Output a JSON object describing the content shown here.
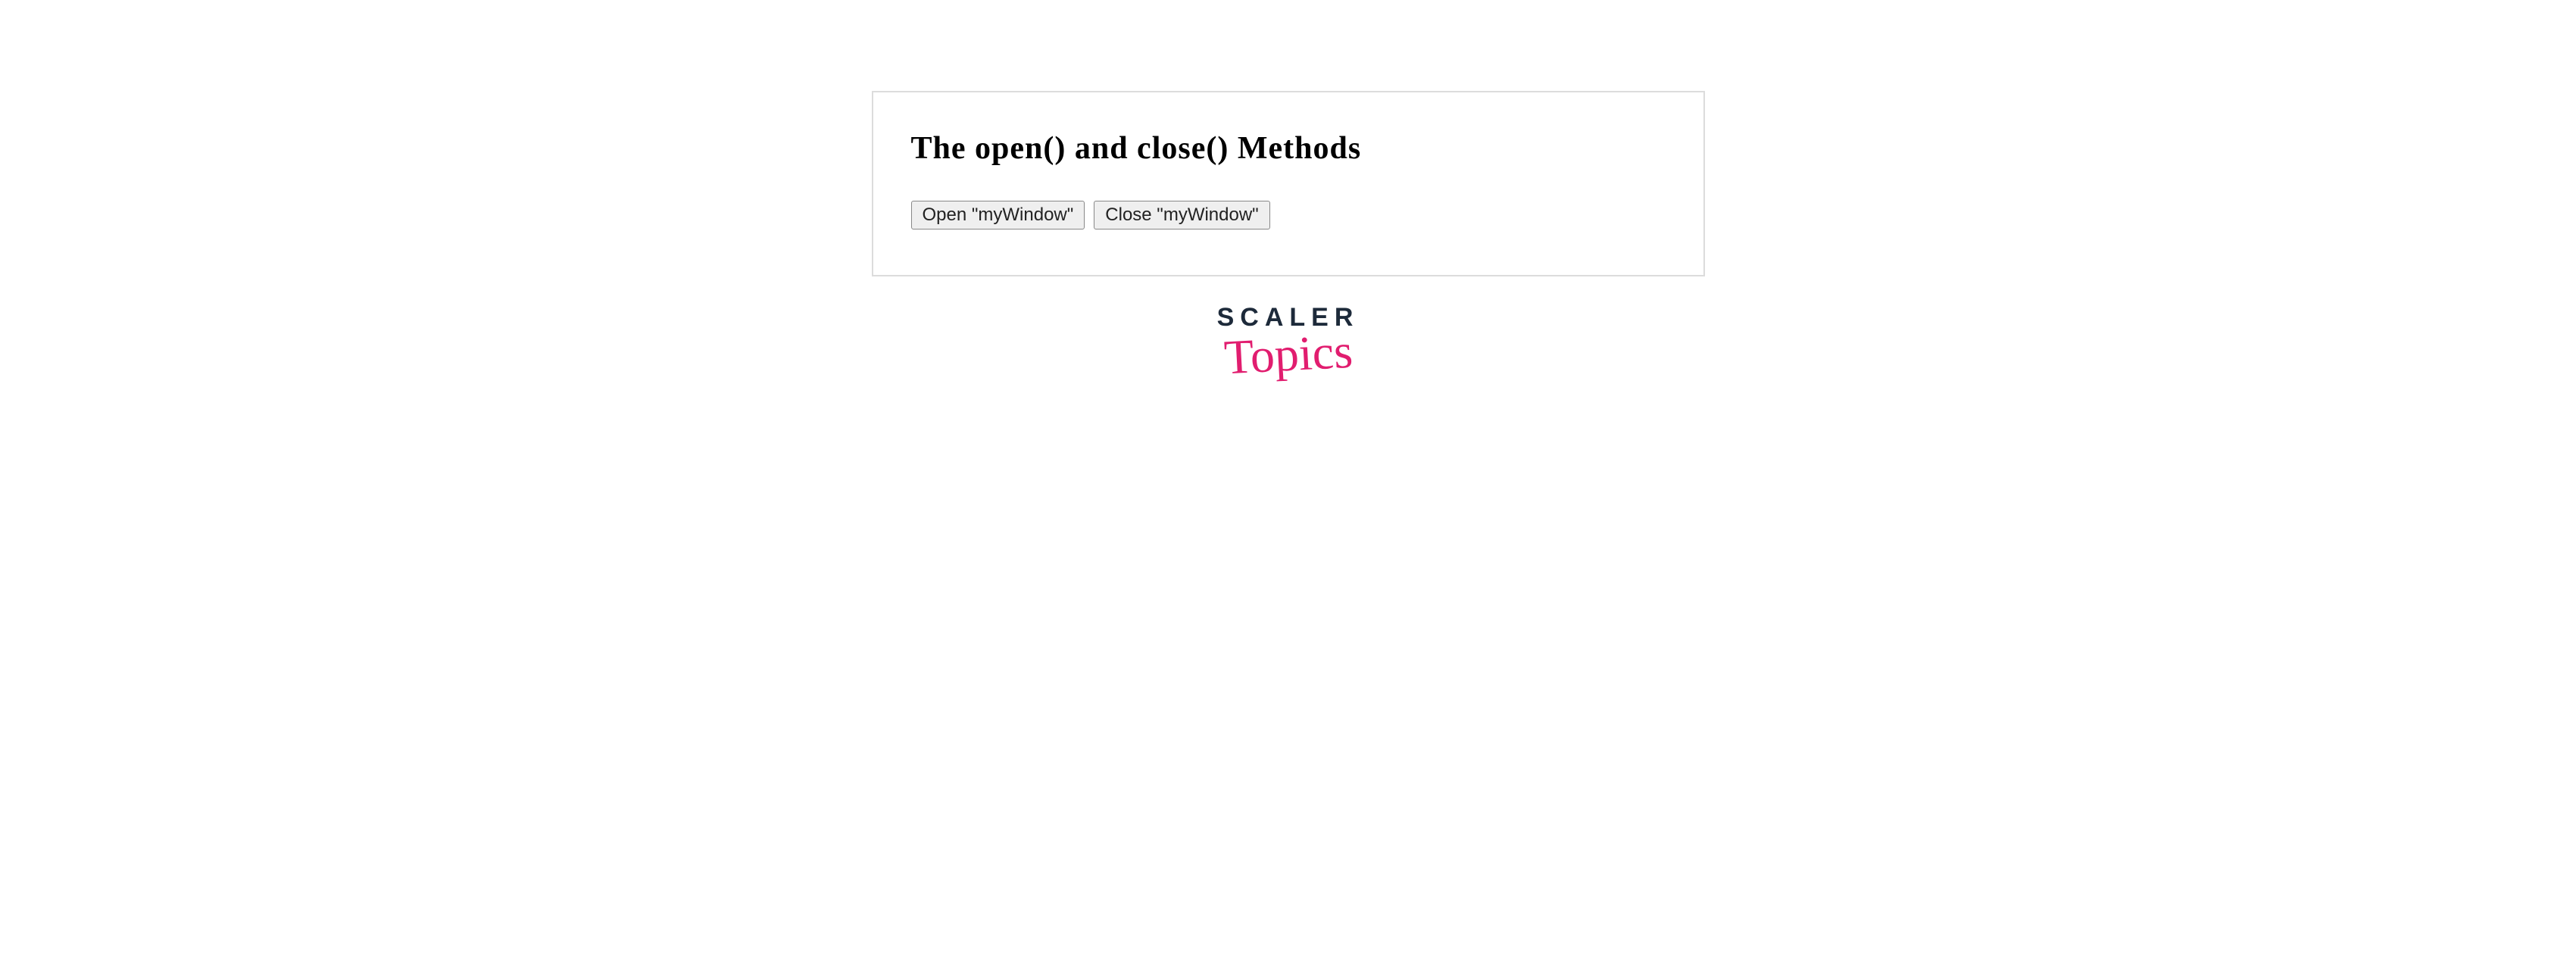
{
  "panel": {
    "heading": "The open() and close() Methods",
    "buttons": {
      "open_label": "Open \"myWindow\"",
      "close_label": "Close \"myWindow\""
    }
  },
  "brand": {
    "line1": "SCALER",
    "line2": "Topics"
  }
}
